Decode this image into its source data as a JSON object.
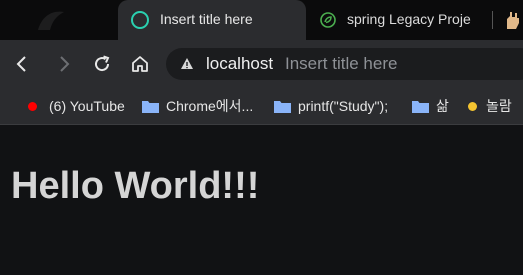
{
  "browser": {
    "tabs": [
      {
        "title": "Insert title here",
        "active": true,
        "icon": "circle-loading-icon",
        "icon_color": "#2ad0b0"
      },
      {
        "title": "spring Legacy Proje",
        "active": false,
        "icon": "spring-leaf-icon",
        "icon_color": "#4caf50"
      },
      {
        "title": "",
        "active": false,
        "icon": "hand-icon",
        "icon_color": "#e0b88a"
      }
    ],
    "toolbar": {
      "back": "back-arrow-icon",
      "forward": "forward-arrow-icon",
      "reload": "reload-icon",
      "home": "home-icon"
    },
    "omnibox": {
      "host": "localhost",
      "title": "Insert title here"
    },
    "bookmarks": [
      {
        "label": "(6) YouTube",
        "icon": "youtube-dot-icon",
        "color": "#ff0000"
      },
      {
        "label": "Chrome에서...",
        "icon": "folder-icon",
        "color": "#8ab4f8"
      },
      {
        "label": "printf(\"Study\");",
        "icon": "folder-icon",
        "color": "#8ab4f8"
      },
      {
        "label": "삶",
        "icon": "folder-icon",
        "color": "#8ab4f8"
      },
      {
        "label": "놀람",
        "icon": "yellow-dot-icon",
        "color": "#f4c430"
      }
    ]
  },
  "page": {
    "heading": "Hello World!!!"
  },
  "colors": {
    "tab_strip": "#0b0b0c",
    "toolbar": "#2b2c2f",
    "omnibox": "#1b1c1e",
    "page_bg": "#111214",
    "heading": "#d5d5d5"
  }
}
